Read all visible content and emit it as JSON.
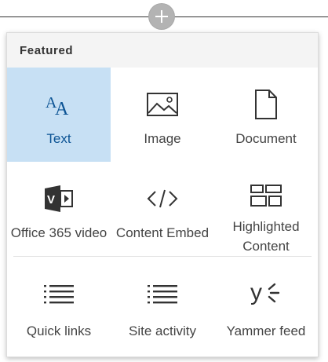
{
  "toolbox": {
    "add_icon": "plus-icon",
    "section_title": "Featured",
    "accent_color": "#c7e0f4",
    "tiles": [
      {
        "label": "Text",
        "icon": "text-icon",
        "selected": true
      },
      {
        "label": "Image",
        "icon": "image-icon",
        "selected": false
      },
      {
        "label": "Document",
        "icon": "document-icon",
        "selected": false
      },
      {
        "label": "Office 365 video",
        "icon": "office-365-video-icon",
        "selected": false
      },
      {
        "label": "Content Embed",
        "icon": "code-embed-icon",
        "selected": false
      },
      {
        "label": "Highlighted Content",
        "icon": "highlighted-content-icon",
        "selected": false
      },
      {
        "label": "Quick links",
        "icon": "quick-links-icon",
        "selected": false
      },
      {
        "label": "Site activity",
        "icon": "site-activity-icon",
        "selected": false
      },
      {
        "label": "Yammer feed",
        "icon": "yammer-icon",
        "selected": false
      }
    ]
  }
}
